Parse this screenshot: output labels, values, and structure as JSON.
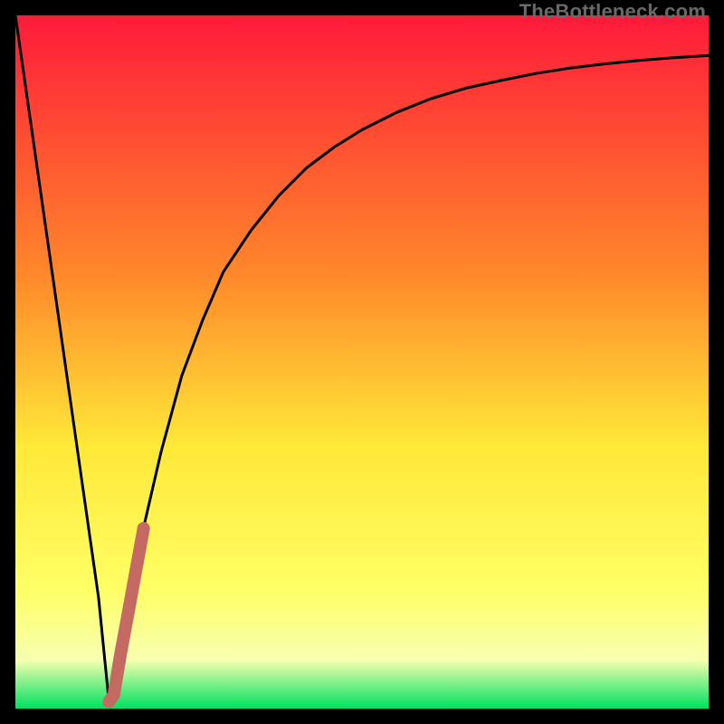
{
  "watermark": "TheBottleneck.com",
  "colors": {
    "frame": "#000000",
    "grad_top": "#ff1a3a",
    "grad_mid1": "#ff8a2a",
    "grad_mid2": "#ffe838",
    "grad_mid3": "#ffff66",
    "grad_mid4": "#f6ffb0",
    "grad_bottom": "#00e060",
    "curve": "#000000",
    "marker": "#c46a63"
  },
  "chart_data": {
    "type": "line",
    "title": "",
    "xlabel": "",
    "ylabel": "",
    "xlim": [
      0,
      100
    ],
    "ylim": [
      0,
      100
    ],
    "series": [
      {
        "name": "bottleneck-curve",
        "x": [
          0,
          3,
          6,
          9,
          12,
          13.5,
          15,
          18,
          21,
          24,
          27,
          30,
          34,
          38,
          42,
          46,
          50,
          55,
          60,
          65,
          70,
          75,
          80,
          85,
          90,
          95,
          100
        ],
        "y": [
          100,
          79,
          58,
          37,
          16,
          1,
          8,
          24,
          37,
          48,
          56,
          63,
          69,
          74,
          78,
          81,
          83.5,
          86,
          88,
          89.5,
          90.6,
          91.6,
          92.4,
          93,
          93.5,
          93.9,
          94.2
        ]
      }
    ],
    "highlight": {
      "name": "marker-segment",
      "x": [
        13.5,
        14.2,
        15.2,
        16.3,
        17.4,
        18.5
      ],
      "y": [
        1,
        2,
        8,
        14,
        20,
        26
      ]
    }
  }
}
